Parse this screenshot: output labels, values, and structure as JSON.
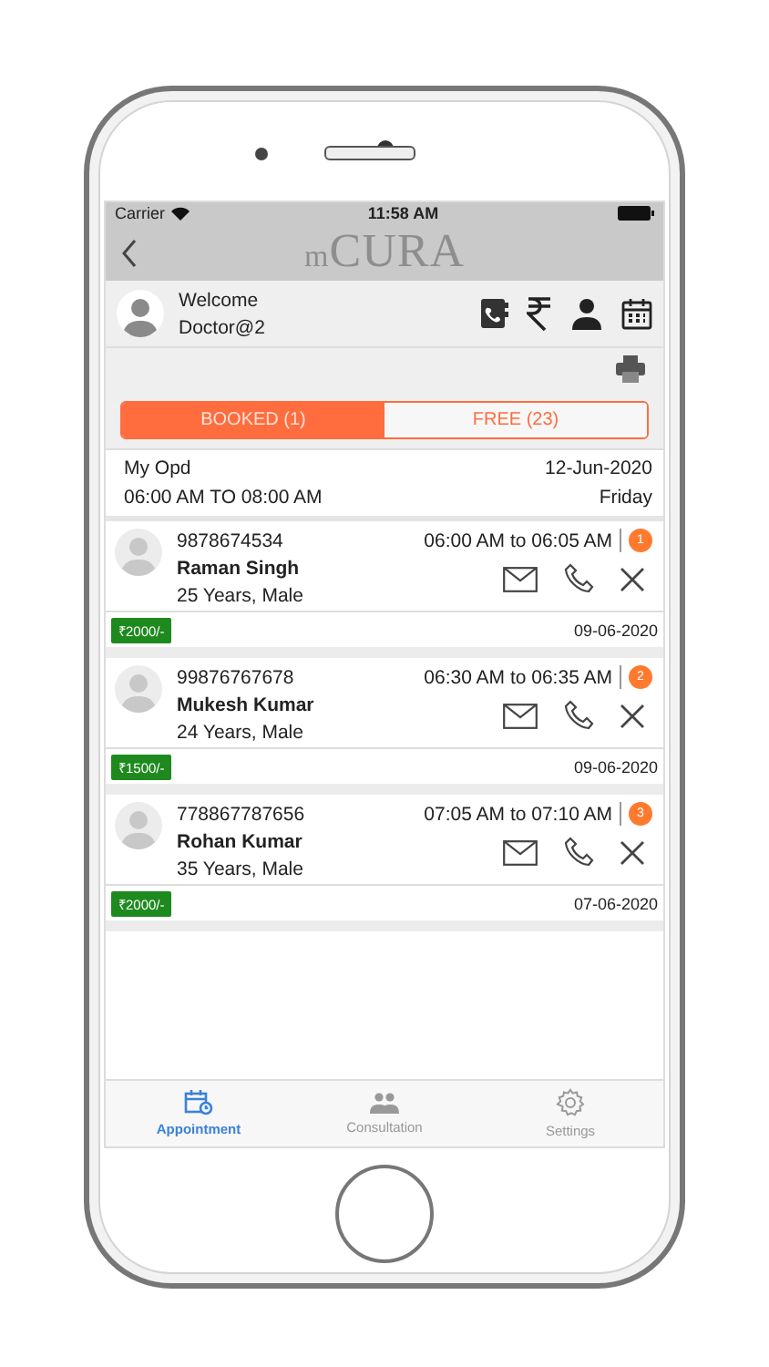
{
  "status_bar": {
    "carrier": "Carrier",
    "time": "11:58 AM"
  },
  "header": {
    "title": "mCURA"
  },
  "user": {
    "greeting": "Welcome",
    "name": "Doctor@2"
  },
  "segments": [
    {
      "label": "BOOKED (1)",
      "selected": true
    },
    {
      "label": "FREE (23)",
      "selected": false
    }
  ],
  "opd": {
    "title": "My Opd",
    "date": "12-Jun-2020",
    "time_range": "06:00 AM TO 08:00 AM",
    "day": "Friday"
  },
  "appointments": [
    {
      "phone": "9878674534",
      "name": "Raman Singh",
      "details": "25 Years, Male",
      "time": "06:00 AM to 06:05 AM",
      "number": "1",
      "fee": "₹2000/-",
      "date": "09-06-2020"
    },
    {
      "phone": "99876767678",
      "name": "Mukesh Kumar",
      "details": "24 Years, Male",
      "time": "06:30 AM to 06:35 AM",
      "number": "2",
      "fee": "₹1500/-",
      "date": "09-06-2020"
    },
    {
      "phone": "778867787656",
      "name": "Rohan Kumar",
      "details": "35 Years, Male",
      "time": "07:05 AM to 07:10 AM",
      "number": "3",
      "fee": "₹2000/-",
      "date": "07-06-2020"
    }
  ],
  "tab_bar": [
    {
      "label": "Appointment",
      "selected": true,
      "kind": "calendar"
    },
    {
      "label": "Consultation",
      "selected": false,
      "kind": "people"
    },
    {
      "label": "Settings",
      "selected": false,
      "kind": "gear"
    }
  ]
}
